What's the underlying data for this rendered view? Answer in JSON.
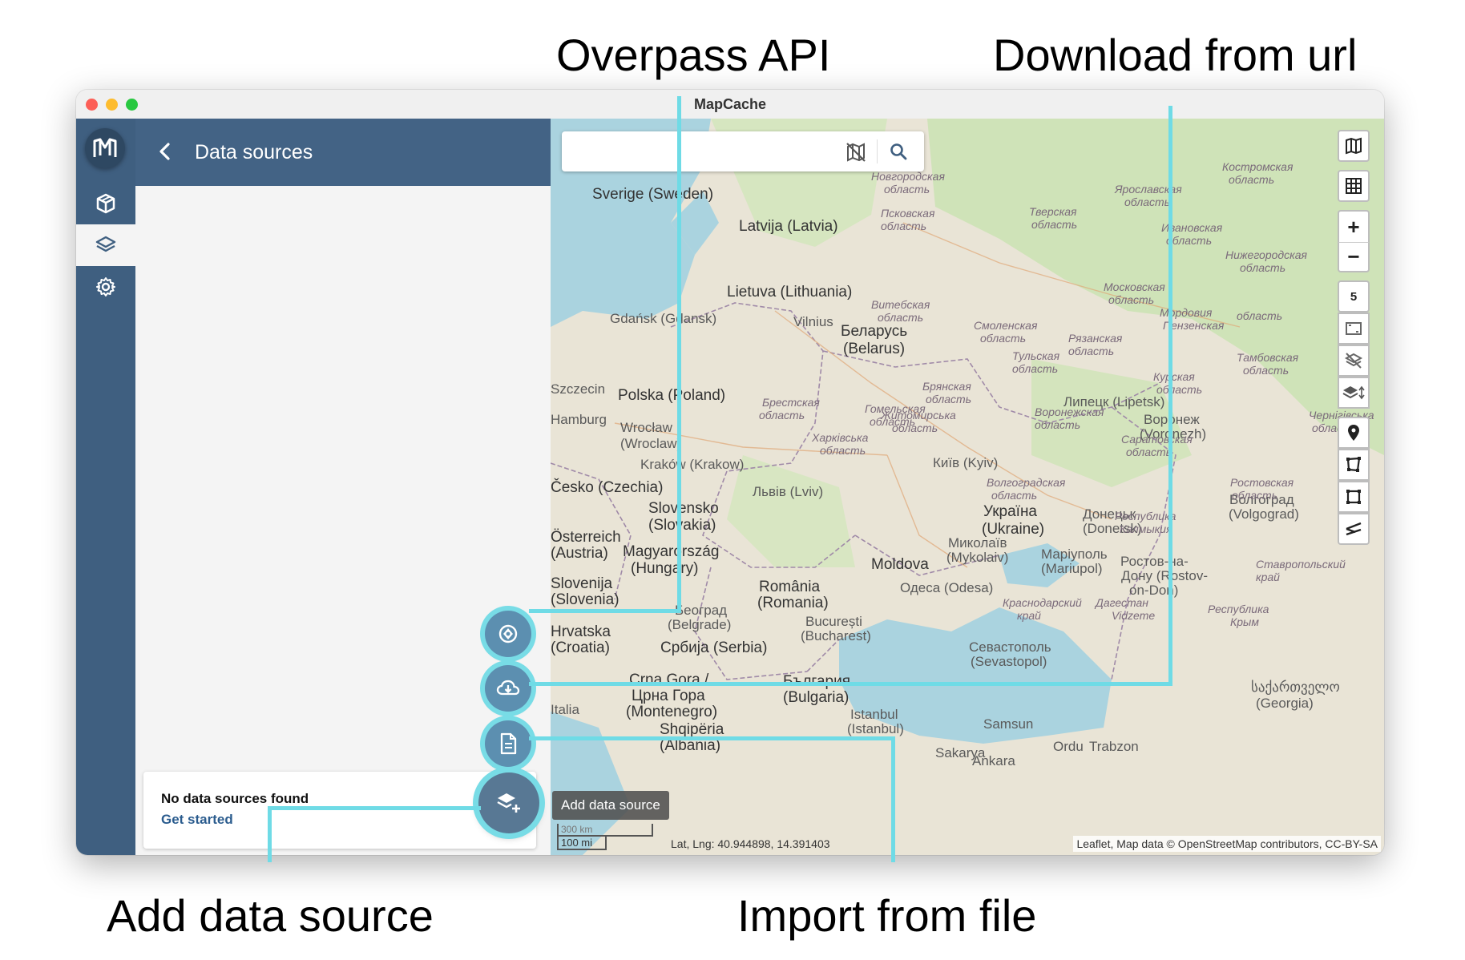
{
  "callouts": {
    "overpass": "Overpass API",
    "download_url": "Download from url",
    "add_data_source": "Add data source",
    "import_file": "Import from file"
  },
  "window": {
    "title": "MapCache"
  },
  "sidebar": {
    "items": [
      {
        "name": "projects",
        "icon": "cube-icon"
      },
      {
        "name": "data-sources",
        "icon": "layers-icon",
        "active": true
      },
      {
        "name": "settings",
        "icon": "gear-icon"
      }
    ]
  },
  "panel": {
    "title": "Data sources",
    "empty_title": "No data sources found",
    "empty_link": "Get started"
  },
  "map": {
    "search_placeholder": "",
    "zoom_level": "5",
    "tooltip": "Add data source",
    "coordinates": "Lat, Lng: 40.944898, 14.391403",
    "scale_km": "300 km",
    "scale_mi": "100 mi",
    "attribution": "Leaflet, Map data © OpenStreetMap contributors, CC-BY-SA",
    "labels": [
      "Sverige (Sweden)",
      "Latvija (Latvia)",
      "Lietuva (Lithuania)",
      "Gdańsk (Gdansk)",
      "Vilnius",
      "Беларусь",
      "(Belarus)",
      "Polska (Poland)",
      "Wrocław",
      "(Wroclaw)",
      "Kraków (Krakow)",
      "Львів (Lviv)",
      "Київ (Kyiv)",
      "Україна",
      "(Ukraine)",
      "Slovensko",
      "(Slovakia)",
      "Magyarország",
      "(Hungary)",
      "Moldova",
      "România",
      "(Romania)",
      "Београд",
      "(Belgrade)",
      "București",
      "(Bucharest)",
      "Србија (Serbia)",
      "Crna Gora /",
      "Црна Гора",
      "(Montenegro)",
      "България",
      "(Bulgaria)",
      "Одеса (Odesa)",
      "Миколаїв",
      "(Mykolaiv)",
      "Маріуполь",
      "(Mariupol)",
      "Донецьк",
      "(Donetsk)",
      "Ростов-на-",
      "Дону (Rostov-",
      "on-Don)",
      "Севастополь",
      "(Sevastopol)",
      "Липецк (Lipetsk)",
      "Воронеж",
      "(Voronezh)",
      "Волгоград",
      "(Volgograd)",
      "Istanbul",
      "(Istanbul)",
      "Samsun",
      "Ordu",
      "Trabzon",
      "Ankara",
      "Sakarya",
      "საქართველო",
      "(Georgia)",
      "Česko (Czechia)",
      "Hrvatska",
      "(Croatia)",
      "Österreich",
      "(Austria)",
      "Slovenija",
      "(Slovenia)",
      "Shqipëria",
      "(Albania)",
      "Szczecin",
      "Hamburg",
      "Italia"
    ],
    "region_labels": [
      "Новгородская",
      "область",
      "Псковская",
      "область",
      "Тверская",
      "область",
      "Ярославская",
      "область",
      "Костромская",
      "область",
      "Ивановская",
      "область",
      "Нижегородская",
      "область",
      "Московская",
      "область",
      "Смоленская",
      "область",
      "Витебская",
      "область",
      "Брестская",
      "область",
      "Гомельская",
      "область",
      "Брянская",
      "область",
      "Тульская",
      "область",
      "Рязанская",
      "область",
      "Мордовия",
      "Пензенская",
      "область",
      "Тамбовская",
      "область",
      "Курская",
      "область",
      "Воронежская",
      "область",
      "Саратовская",
      "область",
      "Чернігівська",
      "область",
      "Житомирська",
      "область",
      "Харківська",
      "область",
      "Волгоградская",
      "область",
      "Ростовская",
      "область",
      "Республика",
      "Калмыкия",
      "Ставропольский",
      "край",
      "Республика",
      "Крым",
      "Краснодарский",
      "край",
      "Дагестан",
      "Vidzeme"
    ]
  },
  "colors": {
    "rail": "#3f5f80",
    "panel_header": "#436385",
    "accent_cyan": "#6fdbe6",
    "fab": "#5c8fb0",
    "sea": "#aad3df",
    "land": "#e7e1d3"
  }
}
